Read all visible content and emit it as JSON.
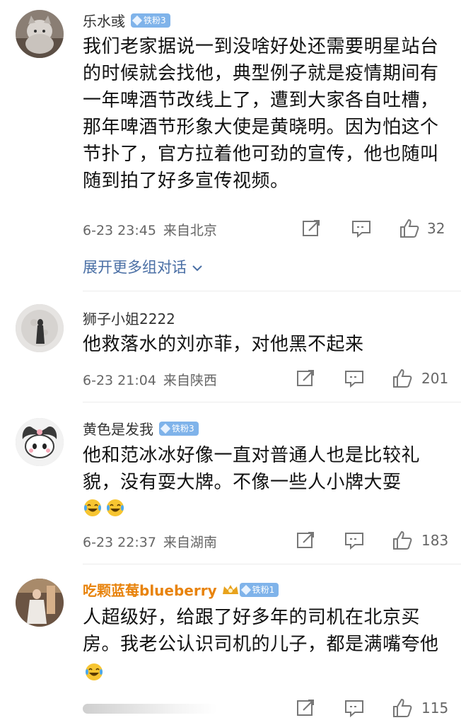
{
  "comments": [
    {
      "username": "乐水彧",
      "badge": "铁粉3",
      "text": "我们老家据说一到没啥好处还需要明星站台的时候就会找他，典型例子就是疫情期间有一年啤酒节改线上了，遭到大家各自吐槽，那年啤酒节形象大使是黄晓明。因为怕这个节扑了，官方拉着他可劲的宣传，他也随叫随到拍了好多宣传视频。",
      "time": "6-23 23:45",
      "location": "来自北京",
      "likes": "32",
      "expand_label": "展开更多组对话"
    },
    {
      "username": "狮子小姐2222",
      "text": "他救落水的刘亦菲，对他黑不起来",
      "time": "6-23 21:04",
      "location": "来自陕西",
      "likes": "201"
    },
    {
      "username": "黄色是发我",
      "badge": "铁粉3",
      "text": "他和范冰冰好像一直对普通人也是比较礼貌，没有耍大牌。不像一些人小牌大耍",
      "time": "6-23 22:37",
      "location": "来自湖南",
      "likes": "183"
    },
    {
      "username": "吃颗蓝莓blueberry",
      "badge": "铁粉1",
      "text": "人超级好，给跟了好多年的司机在北京买房。我老公认识司机的儿子，都是满嘴夸他",
      "likes": "115"
    }
  ],
  "colors": {
    "vip_name": "#e8830c",
    "badge_bg": "#7fb3ea",
    "link": "#4a6fa5",
    "meta": "#666666"
  },
  "icons": [
    "share-icon",
    "comment-icon",
    "like-icon",
    "diamond-badge-icon",
    "crown-icon",
    "laugh-cry-emoji"
  ]
}
